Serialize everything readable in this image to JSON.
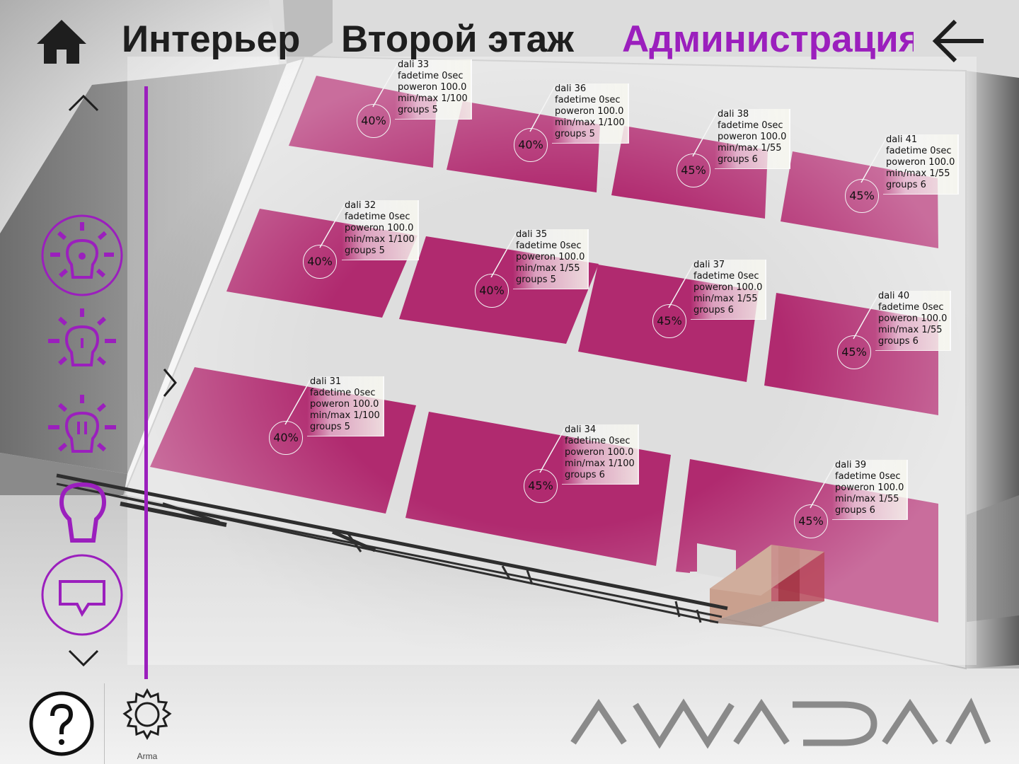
{
  "breadcrumb": {
    "items": [
      "Интерьер",
      "Второй этаж",
      "Администрация"
    ],
    "active_index": 2
  },
  "colors": {
    "accent": "#9b1fbd",
    "light_zone": "#b02a6f",
    "text_dark": "#1e1e1e"
  },
  "sidebar": {
    "tools": [
      {
        "name": "lamp-all-on",
        "icon": "bulb-rays-circled-icon"
      },
      {
        "name": "lamp-on",
        "icon": "bulb-rays-icon"
      },
      {
        "name": "lamp-pause",
        "icon": "bulb-pause-icon"
      },
      {
        "name": "lamp-off",
        "icon": "bulb-outline-icon"
      },
      {
        "name": "messages",
        "icon": "chat-bubble-icon"
      }
    ]
  },
  "footer": {
    "settings_label": "Arma",
    "logo_text": "AWADA"
  },
  "devices": [
    {
      "id": "dali 33",
      "fadetime": "fadetime 0sec",
      "poweron": "poweron 100.0",
      "minmax": "min/max 1/100",
      "groups": "groups 5",
      "level": "40%"
    },
    {
      "id": "dali 36",
      "fadetime": "fadetime 0sec",
      "poweron": "poweron 100.0",
      "minmax": "min/max 1/100",
      "groups": "groups 5",
      "level": "40%"
    },
    {
      "id": "dali 38",
      "fadetime": "fadetime 0sec",
      "poweron": "poweron 100.0",
      "minmax": "min/max 1/55",
      "groups": "groups 6",
      "level": "45%"
    },
    {
      "id": "dali 41",
      "fadetime": "fadetime 0sec",
      "poweron": "poweron 100.0",
      "minmax": "min/max 1/55",
      "groups": "groups 6",
      "level": "45%"
    },
    {
      "id": "dali 32",
      "fadetime": "fadetime 0sec",
      "poweron": "poweron 100.0",
      "minmax": "min/max 1/100",
      "groups": "groups 5",
      "level": "40%"
    },
    {
      "id": "dali 35",
      "fadetime": "fadetime 0sec",
      "poweron": "poweron 100.0",
      "minmax": "min/max 1/55",
      "groups": "groups 5",
      "level": "40%"
    },
    {
      "id": "dali 37",
      "fadetime": "fadetime 0sec",
      "poweron": "poweron 100.0",
      "minmax": "min/max 1/55",
      "groups": "groups 6",
      "level": "45%"
    },
    {
      "id": "dali 40",
      "fadetime": "fadetime 0sec",
      "poweron": "poweron 100.0",
      "minmax": "min/max 1/55",
      "groups": "groups 6",
      "level": "45%"
    },
    {
      "id": "dali 31",
      "fadetime": "fadetime 0sec",
      "poweron": "poweron 100.0",
      "minmax": "min/max 1/100",
      "groups": "groups 5",
      "level": "40%"
    },
    {
      "id": "dali 34",
      "fadetime": "fadetime 0sec",
      "poweron": "poweron 100.0",
      "minmax": "min/max 1/100",
      "groups": "groups 6",
      "level": "45%"
    },
    {
      "id": "dali 39",
      "fadetime": "fadetime 0sec",
      "poweron": "poweron 100.0",
      "minmax": "min/max 1/55",
      "groups": "groups 6",
      "level": "45%"
    }
  ]
}
